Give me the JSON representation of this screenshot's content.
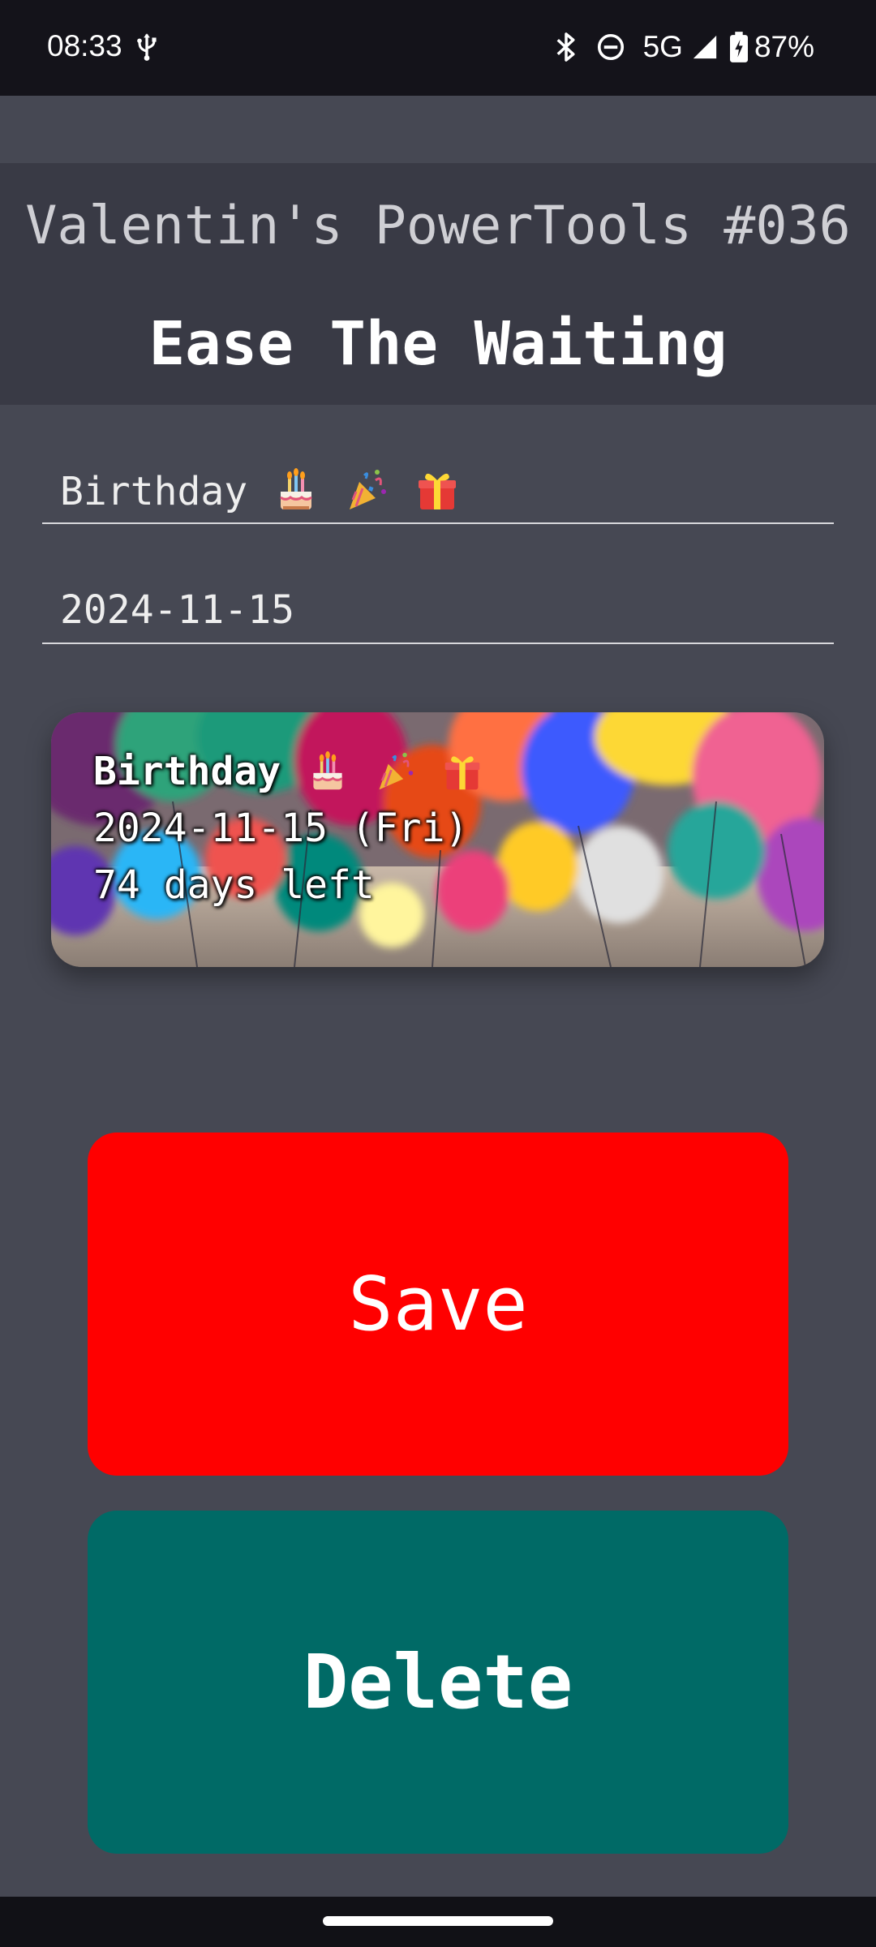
{
  "status_bar": {
    "time": "08:33",
    "network": "5G",
    "battery": "87%",
    "icons": [
      "usb-icon",
      "bluetooth-icon",
      "do-not-disturb-icon",
      "signal-icon",
      "battery-charging-icon"
    ]
  },
  "header": {
    "title": "Valentin's PowerTools #036",
    "subtitle": "Ease The Waiting"
  },
  "form": {
    "event_name": "Birthday",
    "event_name_emojis": [
      "birthday-cake",
      "party-popper",
      "wrapped-gift"
    ],
    "event_date": "2024-11-15"
  },
  "preview": {
    "title": "Birthday",
    "date_line": "2024-11-15 (Fri)",
    "countdown": "74 days left",
    "background": "colorful-balloons-photo"
  },
  "buttons": {
    "save_label": "Save",
    "delete_label": "Delete"
  },
  "colors": {
    "background": "#464853",
    "header_bg": "#393a45",
    "save": "#ff0000",
    "delete": "#006a66"
  }
}
